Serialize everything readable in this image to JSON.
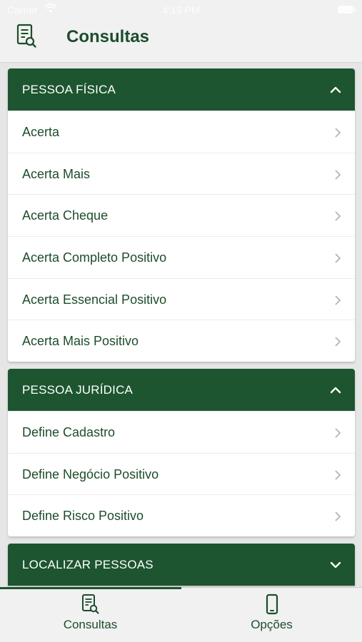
{
  "status_bar": {
    "carrier": "Carrier",
    "time": "4:19 PM"
  },
  "header": {
    "title": "Consultas",
    "icon": "document-search-icon"
  },
  "sections": [
    {
      "title": "PESSOA FÍSICA",
      "expanded": true,
      "items": [
        "Acerta",
        "Acerta Mais",
        "Acerta Cheque",
        "Acerta Completo Positivo",
        "Acerta Essencial Positivo",
        "Acerta Mais Positivo"
      ]
    },
    {
      "title": "PESSOA JURÍDICA",
      "expanded": true,
      "items": [
        "Define Cadastro",
        "Define Negócio Positivo",
        "Define Risco Positivo"
      ]
    },
    {
      "title": "LOCALIZAR PESSOAS",
      "expanded": false,
      "items": []
    }
  ],
  "tabs": [
    {
      "label": "Consultas",
      "icon": "document-search-icon",
      "active": true
    },
    {
      "label": "Opções",
      "icon": "smartphone-icon",
      "active": false
    }
  ],
  "colors": {
    "primary": "#1d5530",
    "text": "#1d4d2b",
    "background": "#e6e6e6",
    "bar": "#f1f1f1"
  }
}
